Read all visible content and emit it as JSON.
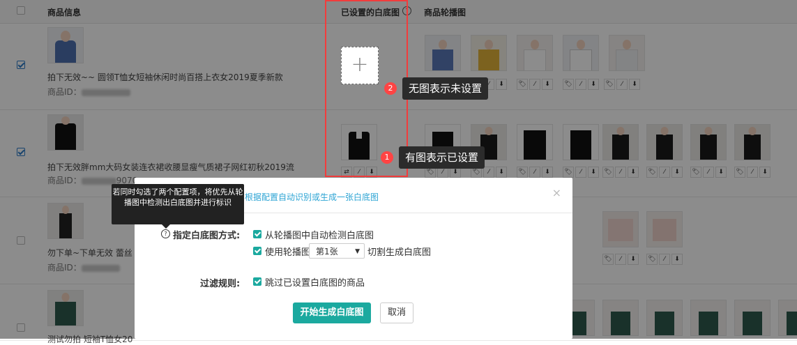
{
  "header": {
    "col_product": "商品信息",
    "col_whitebg": "已设置的白底图",
    "col_carousel": "商品轮播图"
  },
  "rows": [
    {
      "title": "拍下无效~~ 圆领T恤女短袖休闲时尚百搭上衣女2019夏季新款",
      "id_label": "商品ID：",
      "id_value": "",
      "checked": true
    },
    {
      "title": "拍下无效胖mm大码女装连衣裙收腰显瘦气质裙子网红初秋2019流",
      "id_label": "商品ID：",
      "id_value": "9070",
      "checked": true
    },
    {
      "title": "勿下单~下单无效 蕾丝",
      "id_label": "商品ID：",
      "id_value": "",
      "checked": false
    },
    {
      "title": "测试勿拍 短袖T恤女20",
      "id_label": "",
      "id_value": "",
      "checked": false
    }
  ],
  "tool_glyphs": [
    "🏷",
    "⁄",
    "⬇",
    "⇄"
  ],
  "callouts": [
    {
      "num": "2",
      "text": "无图表示未设置"
    },
    {
      "num": "1",
      "text": "有图表示已设置"
    }
  ],
  "add_icon": "+",
  "tooltip": "若同时勾选了两个配置项，将优先从轮播图中检测出白底图并进行标识",
  "dialog": {
    "title": "根据配置自动识别或生成一张白底图",
    "close": "×",
    "method_label": "指定白底图方式:",
    "help_icon": "?",
    "option1": "从轮播图中自动检测白底图",
    "option2_prefix": "使用轮播图",
    "option2_select": "第1张",
    "option2_suffix": "切割生成白底图",
    "filter_label": "过滤规则:",
    "filter_option": "跳过已设置白底图的商品",
    "btn_start": "开始生成白底图",
    "btn_cancel": "取消"
  },
  "colors": {
    "accent": "#1ba99f",
    "annotation": "#f23c3c",
    "link": "#2ca4d4"
  }
}
